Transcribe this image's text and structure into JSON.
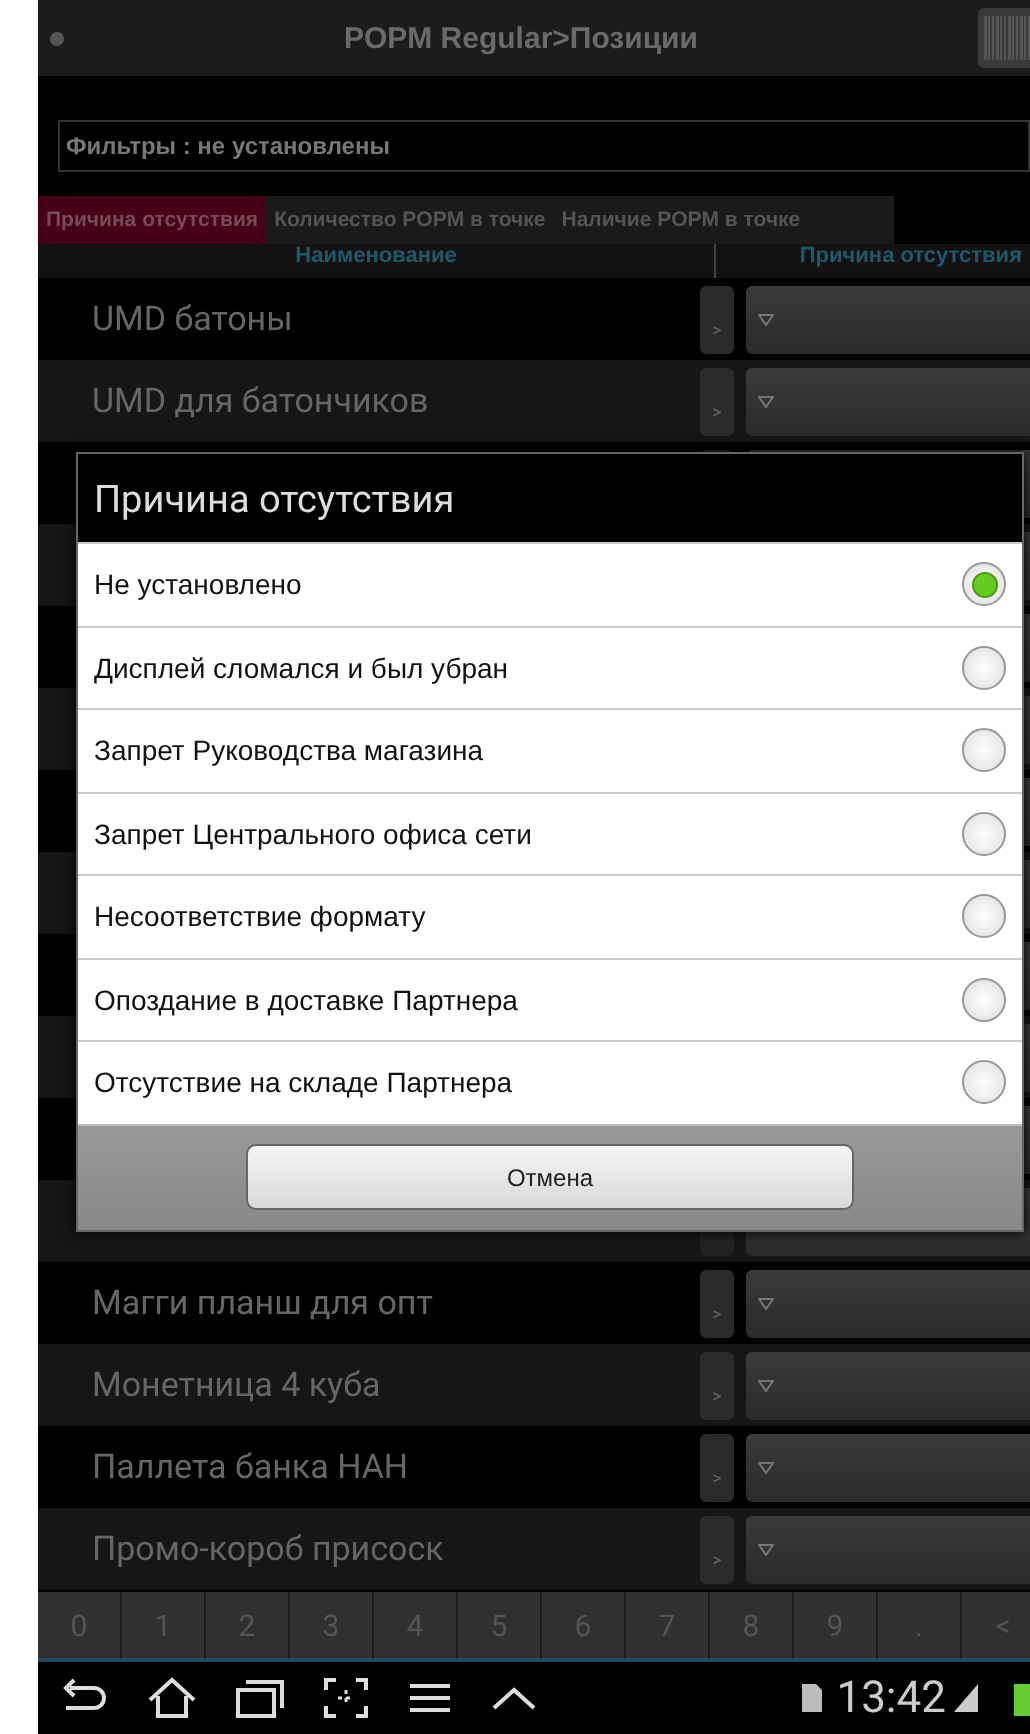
{
  "app_bar": {
    "title": "POPM Regular>Позиции"
  },
  "filter": {
    "value": "Фильтры : не установлены"
  },
  "tabs": [
    {
      "label": "Причина отсутствия",
      "selected": true
    },
    {
      "label": "Количество POPM в точке",
      "selected": false
    },
    {
      "label": "Наличие POPM в точке",
      "selected": false
    }
  ],
  "table": {
    "columns": [
      "Наименование",
      "Причина отсутствия"
    ],
    "rows": [
      {
        "name": "UMD батоны",
        "button": ">"
      },
      {
        "name": "UMD для батончиков",
        "button": ">"
      },
      {},
      {},
      {},
      {},
      {},
      {},
      {},
      {},
      {},
      {},
      {
        "name": "Магги планш для опт",
        "button": ">"
      },
      {
        "name": "Монетница 4 куба",
        "button": ">"
      },
      {
        "name": "Паллета банка НАН",
        "button": ">"
      },
      {
        "name": "Промо-короб присоск",
        "button": ">"
      }
    ]
  },
  "dialog": {
    "title": "Причина отсутствия",
    "options": [
      {
        "label": "Не установлено",
        "selected": true
      },
      {
        "label": "Дисплей сломался и был убран",
        "selected": false
      },
      {
        "label": "Запрет Руководства магазина",
        "selected": false
      },
      {
        "label": "Запрет Центрального офиса сети",
        "selected": false
      },
      {
        "label": "Несоответствие формату",
        "selected": false
      },
      {
        "label": "Опоздание в доставке Партнера",
        "selected": false
      },
      {
        "label": "Отсутствие на складе Партнера",
        "selected": false
      }
    ],
    "cancel": "Отмена"
  },
  "keypad": [
    "0",
    "1",
    "2",
    "3",
    "4",
    "5",
    "6",
    "7",
    "8",
    "9",
    ".",
    "<"
  ],
  "status_bar": {
    "time": "13:42"
  }
}
